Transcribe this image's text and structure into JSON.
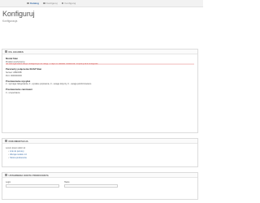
{
  "breadcrumb": {
    "items": [
      {
        "label": "Katalog",
        "icon": "home-icon"
      },
      {
        "label": "Konfiguruj",
        "icon": "folder-icon"
      },
      {
        "label": "Konfiguruj",
        "icon": "folder-icon"
      }
    ]
  },
  "header": {
    "title": "Konfiguruj",
    "subtitle": "Konfiguracja"
  },
  "panel_status": {
    "title": "KS. GS1/DKS",
    "module_status_label": "Moduł Stan",
    "module_status_value": "Produkt uruchomiony",
    "module_status_warning": "Nie skonfigurowano danych dostępowych do usługi. Przejdź do zakładki Ustawienia i uzupełnij dane dostępowe.",
    "params_label": "Parametry połączenia SOAP Stan",
    "params_lines": [
      "Serwer: ABSORB",
      "Port: 0000000000"
    ],
    "processing_label": "Przetwarzanie wysyłek",
    "processing_line": "2 - wymaga zalogowania, 0 - wysłane poprawnie, 0 - uwaga dotyczy, 0 - uwaga poinformowano",
    "orders_label": "Przetwarzanie zamówień",
    "orders_line": "0 - uzupełnianie"
  },
  "panel_help": {
    "title": "DOKUMENTACJA",
    "intro": "Lorem Ipsum dolor sit",
    "links": [
      "Link do pomocy",
      "Wersja modułu 1.0",
      "Strona producenta"
    ]
  },
  "panel_user": {
    "title": "USTAWIENIA KONTA PRODUCENTA",
    "field1_label": "Login",
    "field2_label": "Hasło"
  }
}
